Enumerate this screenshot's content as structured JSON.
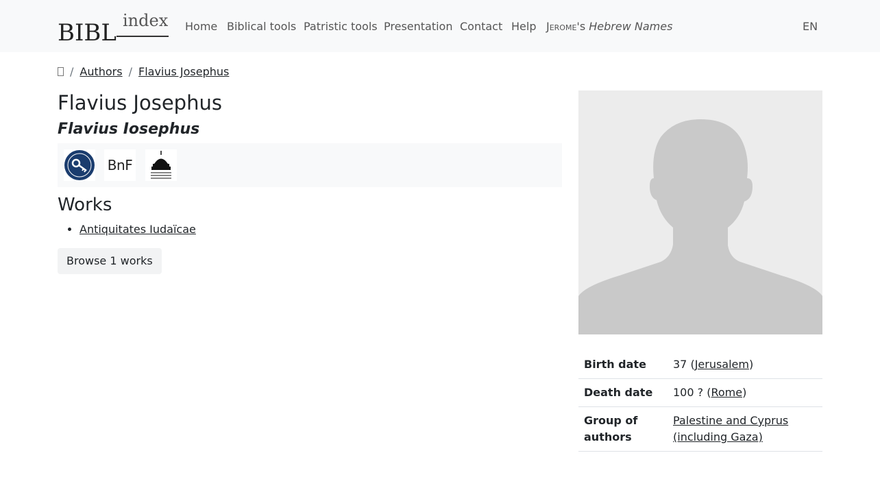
{
  "navbar": {
    "logo": {
      "main": "BIBL",
      "sub": "index"
    },
    "items": [
      {
        "label": "Home"
      },
      {
        "label": "Biblical tools"
      },
      {
        "label": "Patristic tools"
      },
      {
        "label": "Presentation"
      },
      {
        "label": "Contact"
      },
      {
        "label": "Help"
      }
    ],
    "hebrew_names": {
      "sc": "Jerome",
      "sep": "'s",
      "it": "Hebrew Names"
    },
    "language": "EN"
  },
  "breadcrumb": {
    "home_icon": "home-icon",
    "separator": "/",
    "items": [
      "Authors",
      "Flavius Josephus"
    ]
  },
  "author": {
    "name": "Flavius Josephus",
    "latin_name": "Flavius Iosephus"
  },
  "references": [
    {
      "name": "clavis-key-logo",
      "label": ""
    },
    {
      "name": "bnf-logo",
      "label": "BnF"
    },
    {
      "name": "library-of-congress-logo",
      "label": ""
    }
  ],
  "works": {
    "title": "Works",
    "items": [
      "Antiquitates Iudaïcae"
    ],
    "browse_label": "Browse 1 works"
  },
  "info": {
    "birth": {
      "label": "Birth date",
      "value": "37",
      "place": "Jerusalem"
    },
    "death": {
      "label": "Death date",
      "value": "100 ?",
      "place": "Rome"
    },
    "group": {
      "label": "Group of authors",
      "value": "Palestine and Cyprus (including Gaza)"
    }
  },
  "colors": {
    "navbar_bg": "#f8f9fa",
    "text": "#212529",
    "muted": "#555555"
  }
}
